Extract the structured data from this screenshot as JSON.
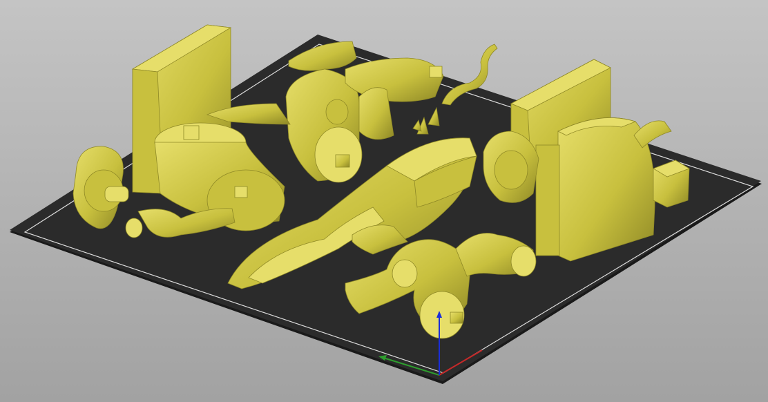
{
  "viewport": {
    "background_top": "#c4c4c4",
    "background_bottom": "#a2a2a2"
  },
  "bed": {
    "surface_color": "#2b2b2b",
    "edge_color": "#1a1a1a",
    "border_line_color": "#dcdcdc"
  },
  "models": {
    "fill_color": "#c8c03e",
    "shadow_color": "#8e8826",
    "highlight_color": "#e6de6a"
  },
  "axes": {
    "x_color": "#c62828",
    "y_color": "#2e9e2e",
    "z_color": "#1a2ed8"
  }
}
